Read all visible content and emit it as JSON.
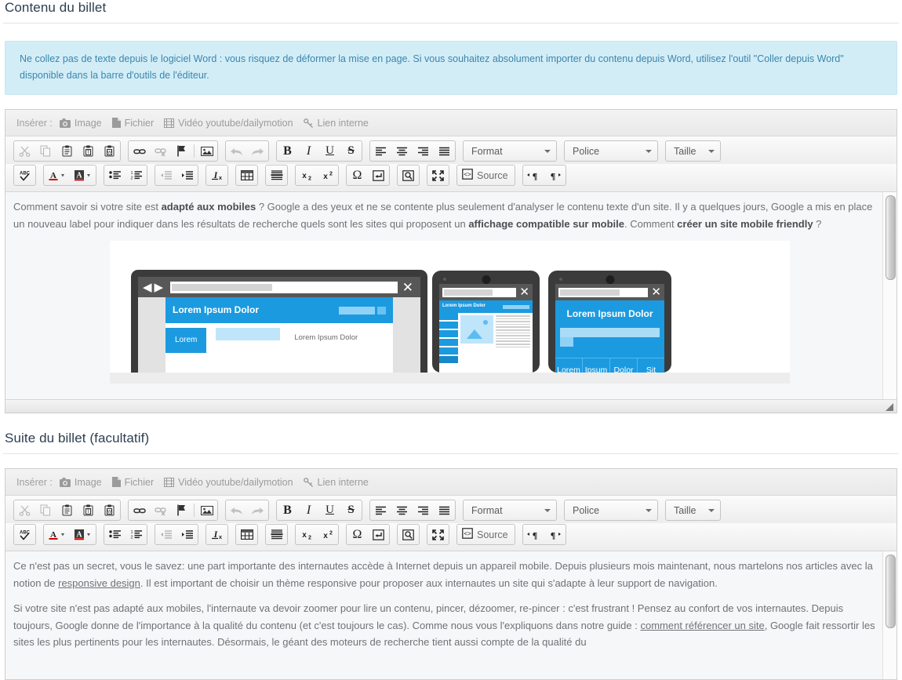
{
  "sections": [
    {
      "title": "Contenu du billet",
      "alert": "Ne collez pas de texte depuis le logiciel Word : vous risquez de déformer la mise en page. Si vous souhaitez absolument importer du contenu depuis Word, utilisez l'outil \"Coller depuis Word\" disponible dans la barre d'outils de l'éditeur."
    },
    {
      "title": "Suite du billet (facultatif)"
    }
  ],
  "insert_bar": {
    "label": "Insérer :",
    "items": [
      {
        "label": "Image",
        "icon": "camera-icon"
      },
      {
        "label": "Fichier",
        "icon": "file-icon"
      },
      {
        "label": "Vidéo youtube/dailymotion",
        "icon": "film-icon"
      },
      {
        "label": "Lien interne",
        "icon": "link-icon"
      }
    ]
  },
  "toolbar": {
    "row1": [
      {
        "group": [
          {
            "name": "cut-button",
            "icon": "scissors-icon",
            "disabled": true
          },
          {
            "name": "copy-button",
            "icon": "copy-icon",
            "disabled": true
          },
          {
            "name": "paste-button",
            "icon": "clipboard-icon",
            "disabled": false
          },
          {
            "name": "paste-as-text-button",
            "icon": "clipboard-text-icon",
            "disabled": false
          },
          {
            "name": "paste-from-word-button",
            "icon": "clipboard-word-icon",
            "disabled": false
          }
        ]
      },
      {
        "group": [
          {
            "name": "link-button",
            "icon": "chain-icon",
            "disabled": false
          },
          {
            "name": "unlink-button",
            "icon": "chain-broken-icon",
            "disabled": true
          },
          {
            "name": "anchor-button",
            "icon": "flag-icon",
            "disabled": false
          },
          {
            "name": "separator",
            "icon": "separator",
            "disabled": false
          },
          {
            "name": "image-button",
            "icon": "picture-icon",
            "disabled": false
          }
        ]
      },
      {
        "group": [
          {
            "name": "undo-button",
            "icon": "undo-arrow-icon",
            "disabled": true
          },
          {
            "name": "redo-button",
            "icon": "redo-arrow-icon",
            "disabled": true
          }
        ]
      },
      {
        "group": [
          {
            "name": "bold-button",
            "icon": "bold-icon",
            "glyph": "B",
            "disabled": false
          },
          {
            "name": "italic-button",
            "icon": "italic-icon",
            "glyph": "I",
            "disabled": false
          },
          {
            "name": "underline-button",
            "icon": "underline-icon",
            "glyph": "U",
            "disabled": false
          },
          {
            "name": "strikethrough-button",
            "icon": "strikethrough-icon",
            "glyph": "S",
            "disabled": false
          }
        ]
      },
      {
        "group": [
          {
            "name": "align-left-button",
            "icon": "align-left-icon",
            "disabled": false
          },
          {
            "name": "align-center-button",
            "icon": "align-center-icon",
            "disabled": false
          },
          {
            "name": "align-right-button",
            "icon": "align-right-icon",
            "disabled": false
          },
          {
            "name": "align-justify-button",
            "icon": "align-justify-icon",
            "disabled": false
          }
        ]
      }
    ],
    "combos": [
      {
        "name": "format-select",
        "label": "Format"
      },
      {
        "name": "font-select",
        "label": "Police"
      },
      {
        "name": "size-select",
        "label": "Taille"
      }
    ],
    "row2": [
      {
        "group": [
          {
            "name": "spellcheck-button",
            "icon": "spellcheck-abc-icon"
          }
        ]
      },
      {
        "group": [
          {
            "name": "text-color-button",
            "icon": "text-color-icon"
          },
          {
            "name": "background-color-button",
            "icon": "background-color-icon"
          }
        ]
      },
      {
        "group": [
          {
            "name": "bulleted-list-button",
            "icon": "bulleted-list-icon"
          },
          {
            "name": "numbered-list-button",
            "icon": "numbered-list-icon"
          }
        ]
      },
      {
        "group": [
          {
            "name": "outdent-button",
            "icon": "outdent-icon",
            "disabled": true
          },
          {
            "name": "indent-button",
            "icon": "indent-icon",
            "disabled": false
          }
        ]
      },
      {
        "group": [
          {
            "name": "remove-format-button",
            "icon": "remove-format-icon"
          }
        ]
      },
      {
        "group": [
          {
            "name": "table-button",
            "icon": "table-icon"
          }
        ]
      },
      {
        "group": [
          {
            "name": "horizontal-rule-button",
            "icon": "horizontal-rule-icon"
          }
        ]
      },
      {
        "group": [
          {
            "name": "subscript-button",
            "icon": "subscript-icon"
          },
          {
            "name": "superscript-button",
            "icon": "superscript-icon"
          }
        ]
      },
      {
        "group": [
          {
            "name": "special-char-button",
            "icon": "omega-icon"
          },
          {
            "name": "page-break-button",
            "icon": "page-break-icon"
          }
        ]
      },
      {
        "group": [
          {
            "name": "preview-button",
            "icon": "preview-icon"
          }
        ]
      },
      {
        "group": [
          {
            "name": "maximize-button",
            "icon": "maximize-icon"
          }
        ]
      },
      {
        "group": [
          {
            "name": "source-button",
            "icon": "source-icon",
            "label": "Source"
          }
        ]
      },
      {
        "group": [
          {
            "name": "ltr-button",
            "icon": "text-direction-ltr-icon"
          },
          {
            "name": "rtl-button",
            "icon": "text-direction-rtl-icon"
          }
        ]
      }
    ]
  },
  "editor1": {
    "paragraph_parts": [
      {
        "text": "Comment savoir si votre site est ",
        "bold": false
      },
      {
        "text": "adapté aux mobiles",
        "bold": true
      },
      {
        "text": " ? Google a des yeux et ne se contente plus seulement d'analyser le contenu texte d'un site. Il y a quelques jours, Google a mis en place un nouveau label pour indiquer dans les résultats de recherche quels sont les sites qui proposent un ",
        "bold": false
      },
      {
        "text": "affichage compatible sur mobile",
        "bold": true
      },
      {
        "text": ". Comment ",
        "bold": false
      },
      {
        "text": "créer un site mobile friendly",
        "bold": true
      },
      {
        "text": " ?",
        "bold": false
      }
    ],
    "image": {
      "name": "responsive-devices-illustration",
      "laptop_title": "Lorem Ipsum Dolor",
      "laptop_tab": "Lorem",
      "laptop_caption": "Lorem Ipsum Dolor",
      "tablet_title": "Lorem Ipsum Dolor",
      "phone_title": "Lorem Ipsum Dolor",
      "phone_menu": [
        "Lorem",
        "Ipsum",
        "Dolor",
        "Sit"
      ]
    }
  },
  "editor2": {
    "paragraph1_parts": [
      {
        "text": "Ce n'est pas un secret, vous le savez: une part importante des internautes accède à Internet depuis un appareil mobile. Depuis plusieurs mois maintenant, nous martelons nos articles avec la notion de ",
        "link": false
      },
      {
        "text": "responsive design",
        "link": true
      },
      {
        "text": ". Il est important de choisir un thème responsive pour proposer aux internautes un site qui s'adapte à leur support de navigation.",
        "link": false
      }
    ],
    "paragraph2_parts": [
      {
        "text": "Si votre site n'est pas adapté aux mobiles, l'internaute va devoir zoomer pour lire un contenu, pincer, dézoomer, re-pincer : c'est frustrant ! Pensez au confort de vos internautes. Depuis toujours, Google donne de l'importance à la qualité du contenu (et c'est toujours le cas). Comme nous vous l'expliquons dans notre guide : ",
        "link": false
      },
      {
        "text": "comment référencer un site",
        "link": true
      },
      {
        "text": ", Google fait ressortir les sites les plus pertinents pour les internautes. Désormais, le géant des moteurs de recherche tient aussi compte de la qualité du",
        "link": false
      }
    ]
  },
  "colors": {
    "alert_bg": "#d3edf7",
    "alert_text": "#3a87ad",
    "accent_blue": "#1b9ae0",
    "content_bg": "#f6f7f8",
    "text": "#6f7276"
  }
}
